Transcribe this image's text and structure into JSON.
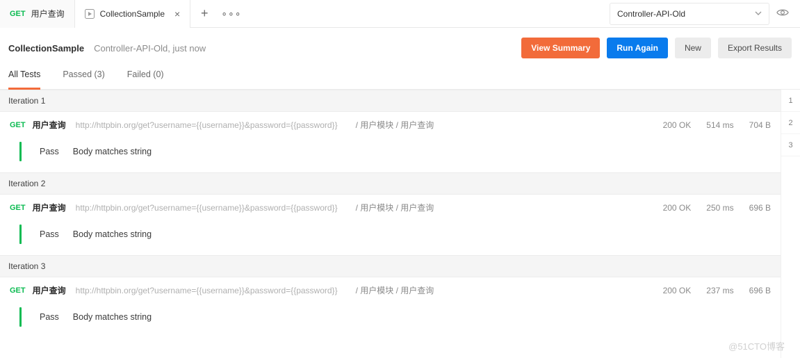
{
  "tabs": [
    {
      "method": "GET",
      "label": "用户查询",
      "closable": false
    },
    {
      "runner": true,
      "label": "CollectionSample",
      "closable": true
    }
  ],
  "env": {
    "selected": "Controller-API-Old"
  },
  "header": {
    "title": "CollectionSample",
    "meta": "Controller-API-Old, just now"
  },
  "buttons": {
    "summary": "View Summary",
    "run": "Run Again",
    "new": "New",
    "export": "Export Results"
  },
  "filters": {
    "all": "All Tests",
    "passed": "Passed (3)",
    "failed": "Failed (0)"
  },
  "iterations": [
    {
      "title": "Iteration 1",
      "request": {
        "method": "GET",
        "name": "用户查询",
        "url": "http://httpbin.org/get?username={{username}}&password={{password}}",
        "path": "/ 用户模块 / 用户查询",
        "status": "200 OK",
        "time": "514 ms",
        "size": "704 B"
      },
      "test": {
        "result": "Pass",
        "desc": "Body matches string"
      }
    },
    {
      "title": "Iteration 2",
      "request": {
        "method": "GET",
        "name": "用户查询",
        "url": "http://httpbin.org/get?username={{username}}&password={{password}}",
        "path": "/ 用户模块 / 用户查询",
        "status": "200 OK",
        "time": "250 ms",
        "size": "696 B"
      },
      "test": {
        "result": "Pass",
        "desc": "Body matches string"
      }
    },
    {
      "title": "Iteration 3",
      "request": {
        "method": "GET",
        "name": "用户查询",
        "url": "http://httpbin.org/get?username={{username}}&password={{password}}",
        "path": "/ 用户模块 / 用户查询",
        "status": "200 OK",
        "time": "237 ms",
        "size": "696 B"
      },
      "test": {
        "result": "Pass",
        "desc": "Body matches string"
      }
    }
  ],
  "rail": [
    "1",
    "2",
    "3"
  ],
  "watermark": "@51CTO博客"
}
